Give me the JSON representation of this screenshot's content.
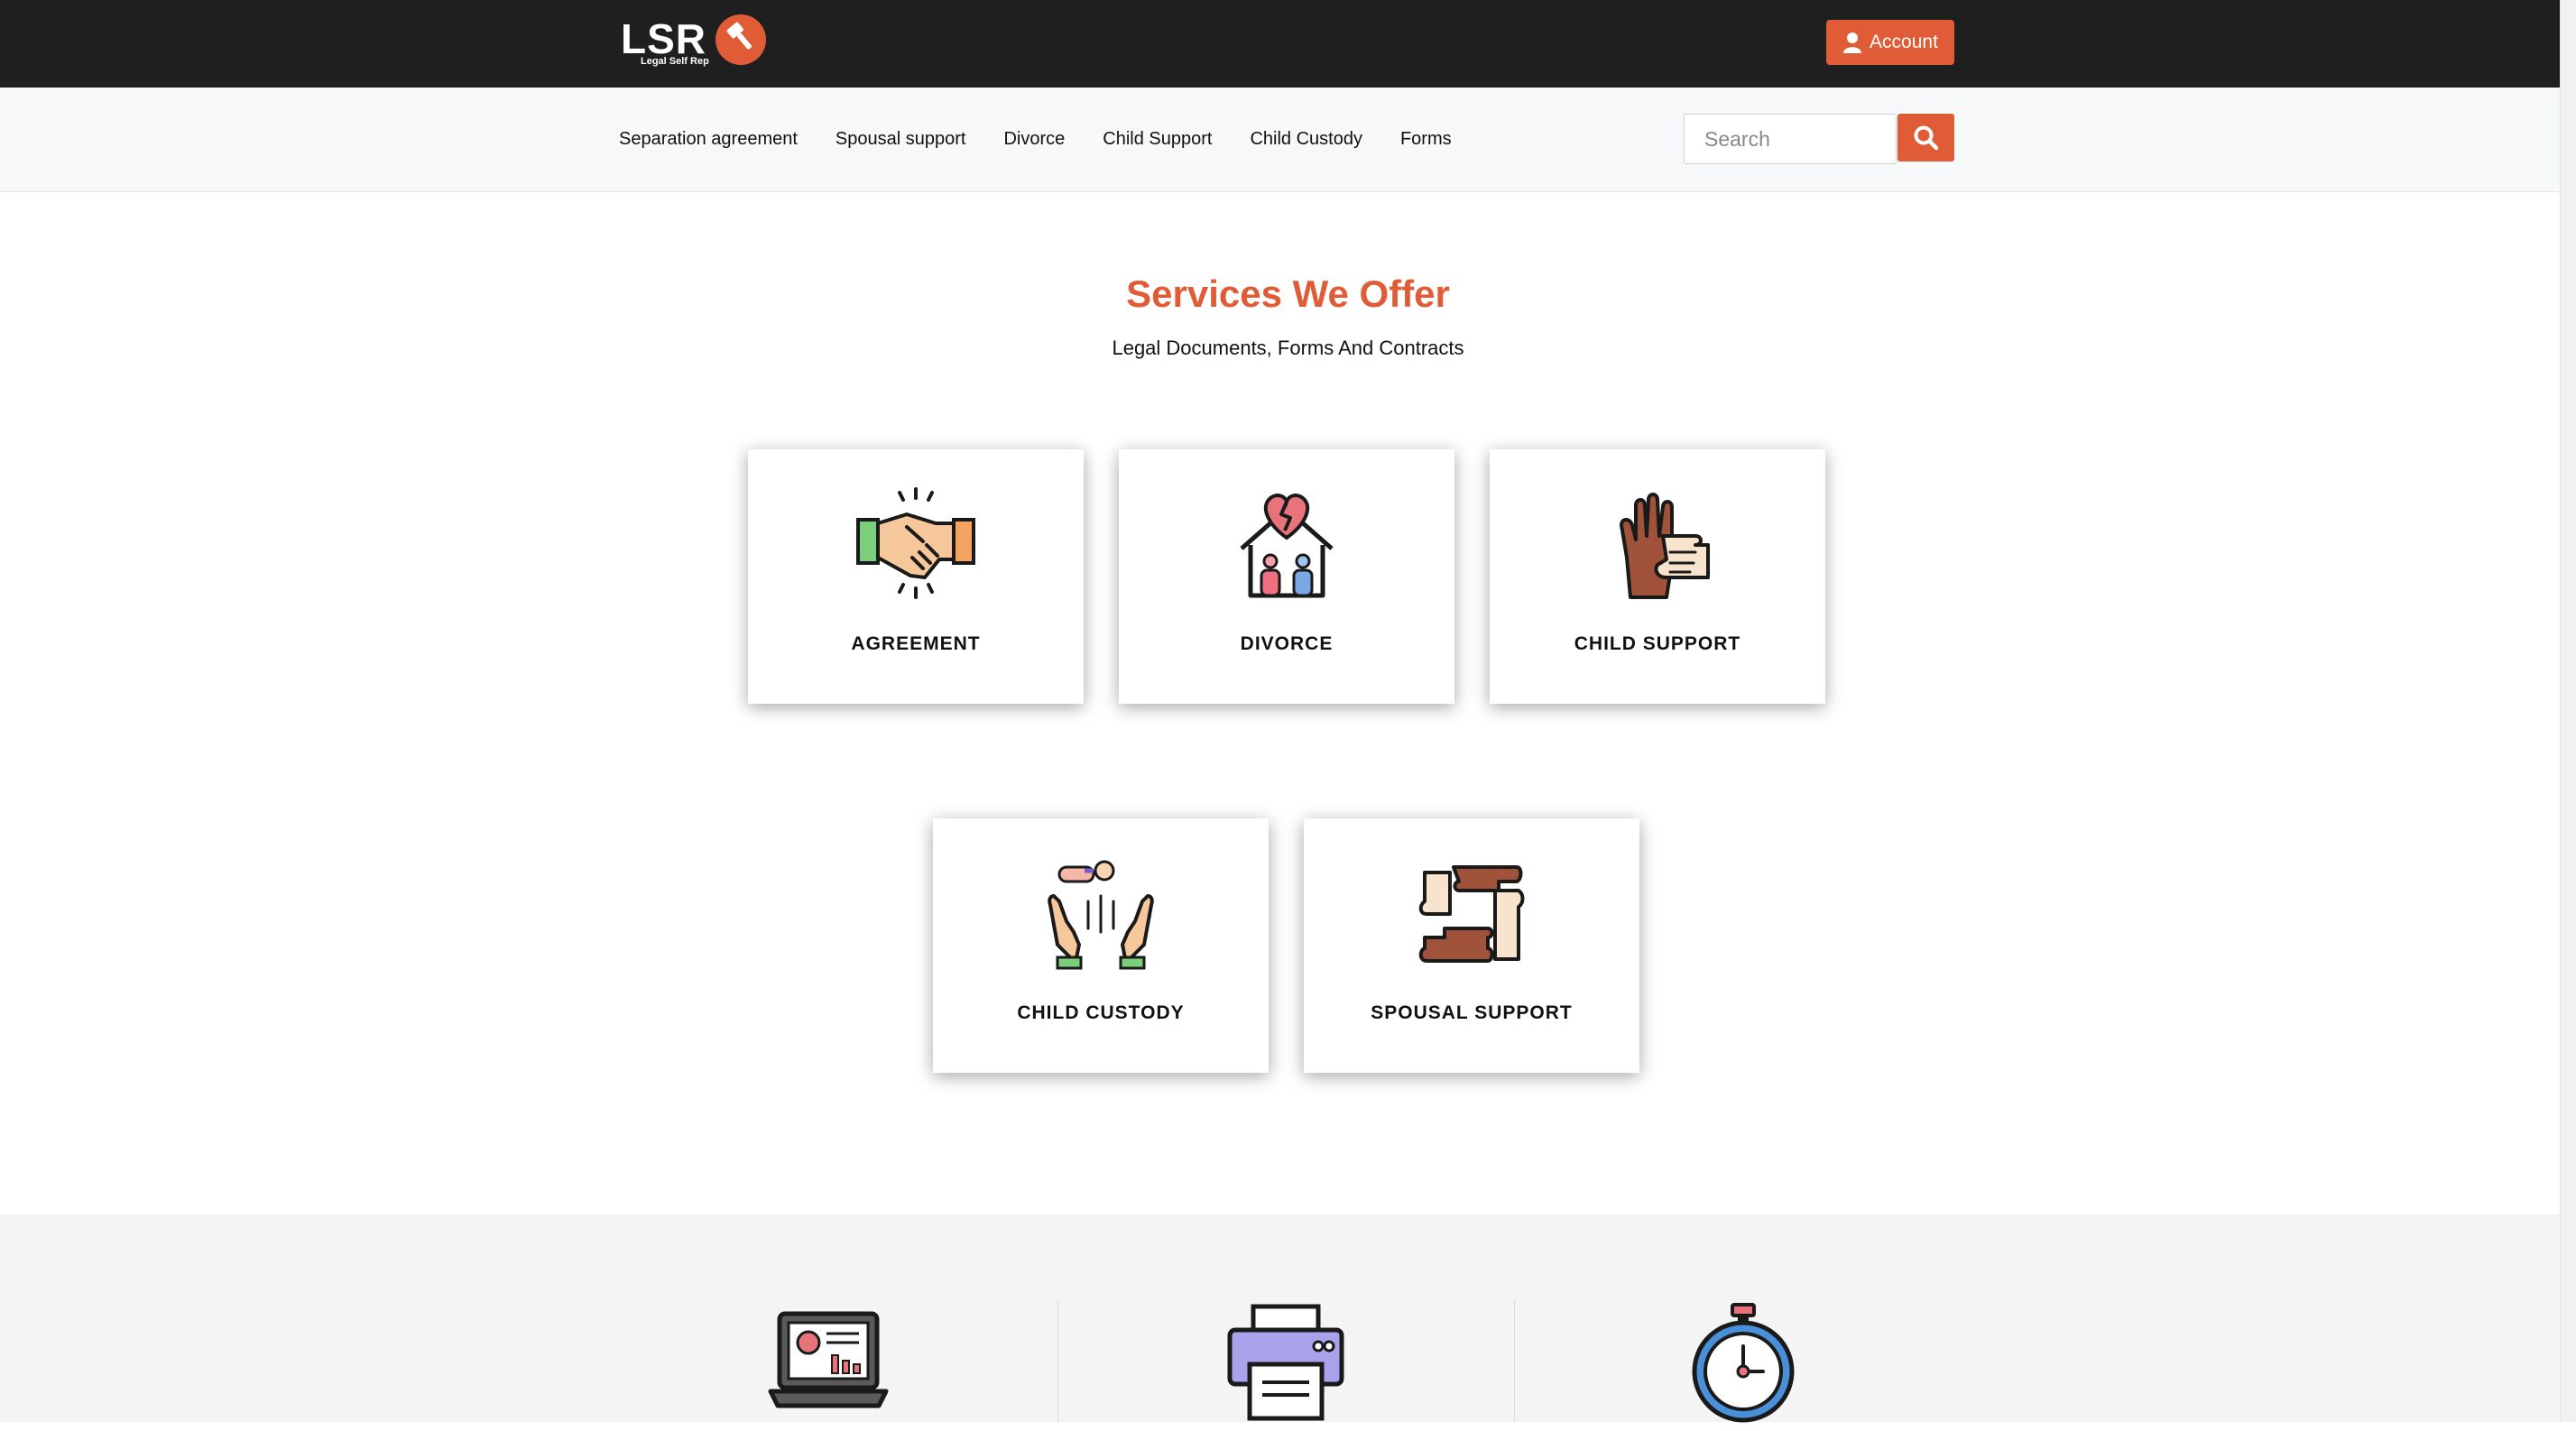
{
  "header": {
    "logo_text": "LSR",
    "logo_subtitle": "Legal Self Rep",
    "account_label": "Account"
  },
  "nav": {
    "items": [
      {
        "label": "Separation agreement"
      },
      {
        "label": "Spousal support"
      },
      {
        "label": "Divorce"
      },
      {
        "label": "Child Support"
      },
      {
        "label": "Child Custody"
      },
      {
        "label": "Forms"
      }
    ],
    "search_placeholder": "Search"
  },
  "services": {
    "title": "Services We Offer",
    "subtitle": "Legal Documents, Forms And Contracts",
    "cards": [
      {
        "label": "AGREEMENT",
        "icon": "handshake-icon"
      },
      {
        "label": "DIVORCE",
        "icon": "broken-heart-house-icon"
      },
      {
        "label": "CHILD SUPPORT",
        "icon": "hands-support-icon"
      },
      {
        "label": "CHILD CUSTODY",
        "icon": "baby-hands-icon"
      },
      {
        "label": "SPOUSAL SUPPORT",
        "icon": "hands-square-icon"
      }
    ]
  },
  "features": {
    "icons": [
      "laptop-chart-icon",
      "printer-icon",
      "stopwatch-icon"
    ]
  },
  "colors": {
    "accent": "#e05c37",
    "topbar": "#1f1f1f",
    "navbar": "#f7f8fa"
  }
}
